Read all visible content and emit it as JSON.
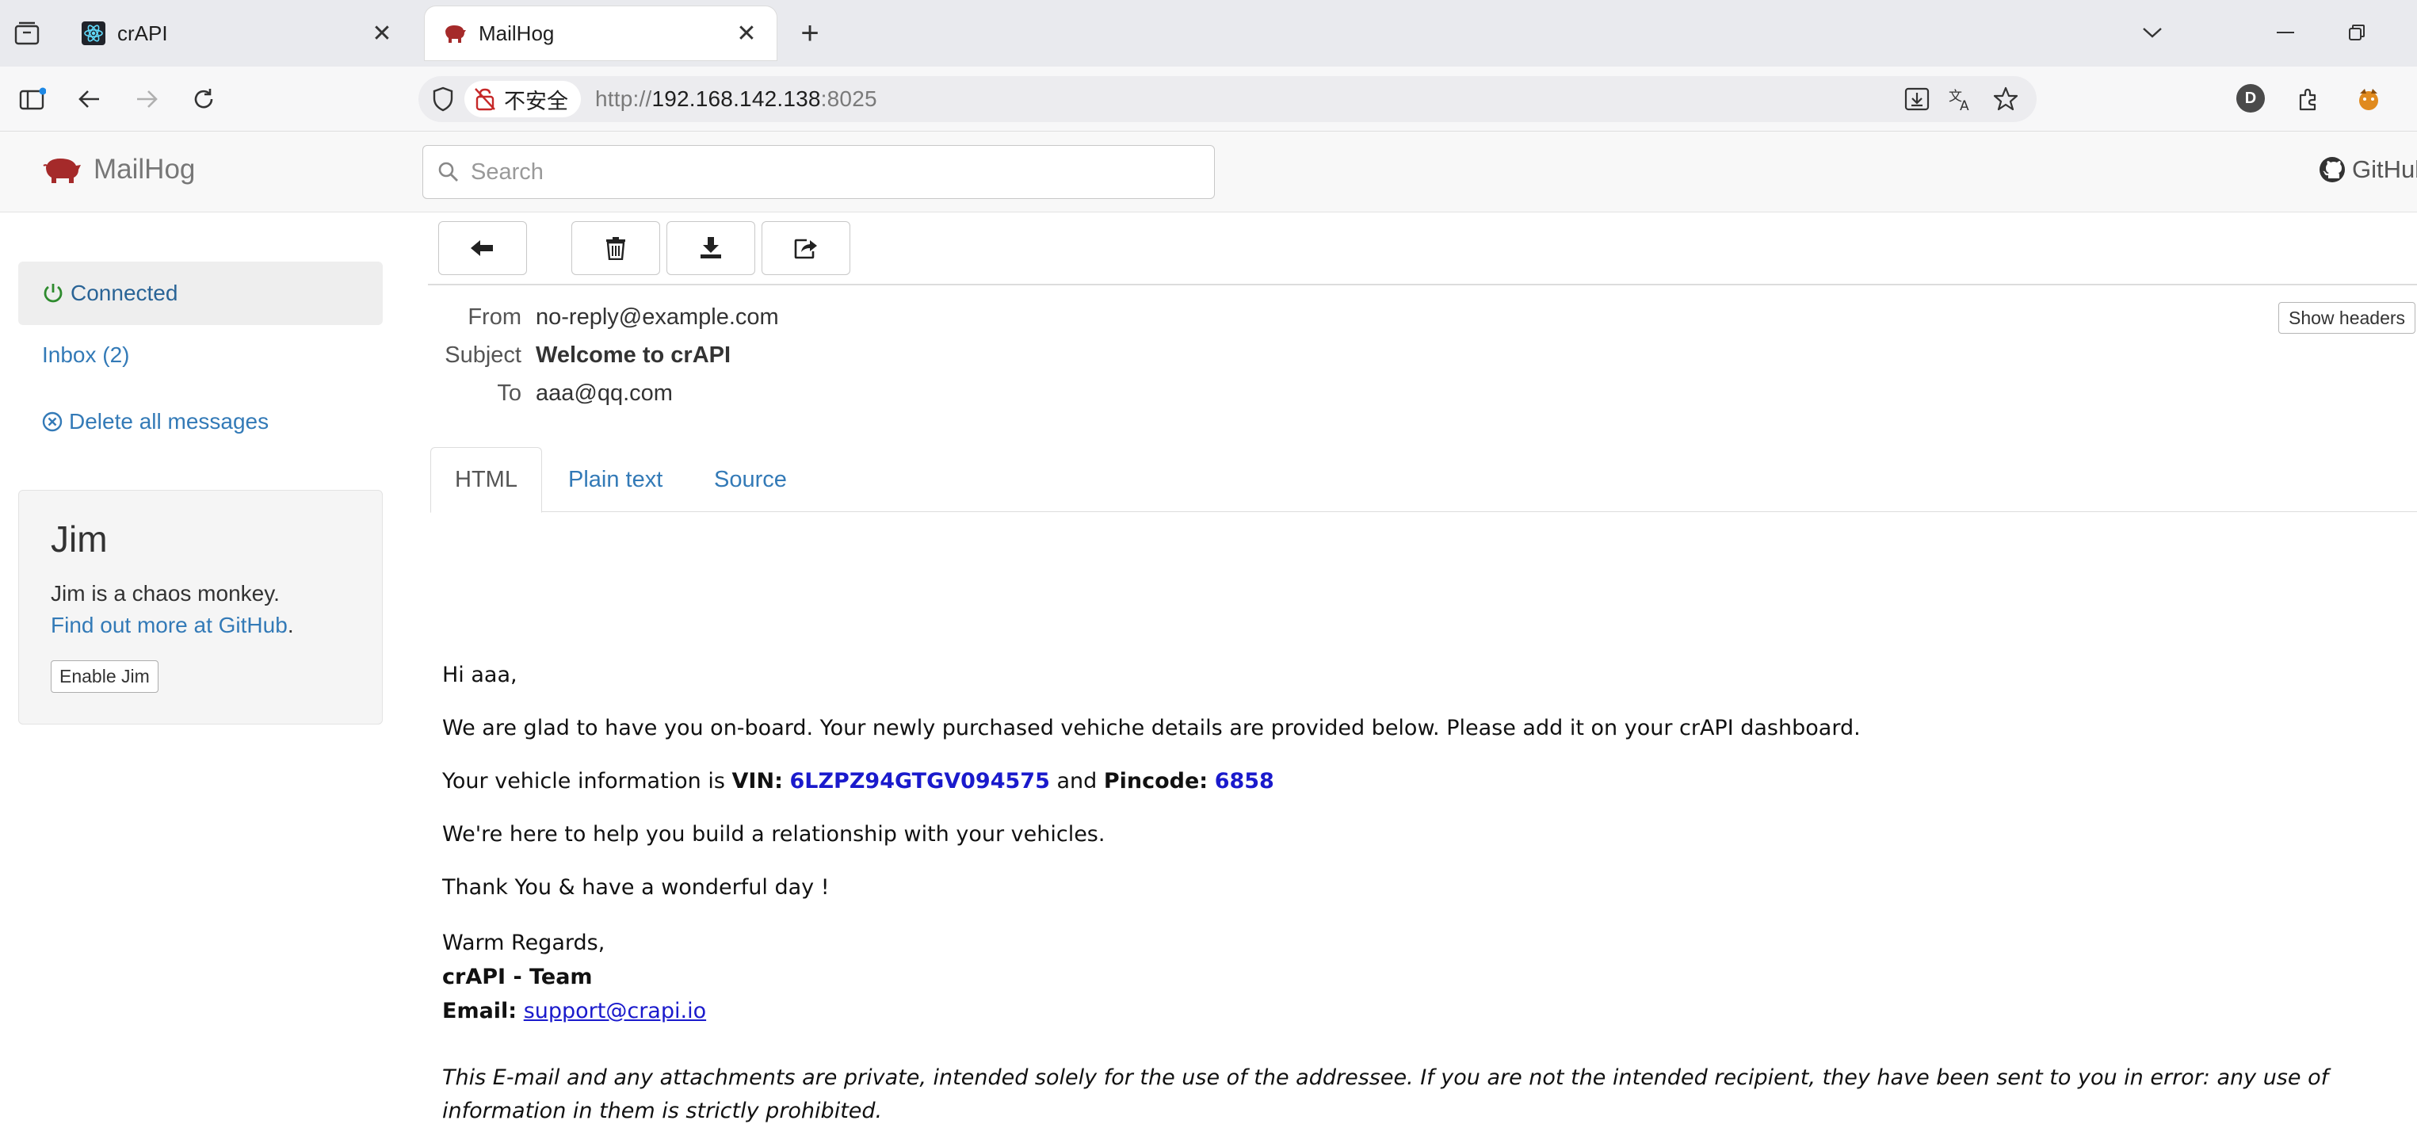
{
  "browser": {
    "tabs": [
      {
        "title": "crAPI",
        "active": false
      },
      {
        "title": "MailHog",
        "active": true
      }
    ],
    "security_label": "不安全",
    "url_scheme": "http://",
    "url_host": "192.168.142.138",
    "url_port": ":8025",
    "profile_initial": "D"
  },
  "mailhog": {
    "brand": "MailHog",
    "search_placeholder": "Search",
    "github_label": "GitHub"
  },
  "sidebar": {
    "connected": "Connected",
    "inbox": "Inbox (2)",
    "delete_all": "Delete all messages",
    "jim": {
      "title": "Jim",
      "text": "Jim is a chaos monkey.",
      "link": "Find out more at GitHub",
      "link_suffix": ".",
      "button": "Enable Jim"
    }
  },
  "message": {
    "headers": {
      "from_label": "From",
      "from": "no-reply@example.com",
      "subject_label": "Subject",
      "subject": "Welcome to crAPI",
      "to_label": "To",
      "to": "aaa@qq.com"
    },
    "show_headers": "Show headers",
    "tabs": [
      "HTML",
      "Plain text",
      "Source"
    ],
    "body": {
      "greeting": "Hi aaa,",
      "line1": "We are glad to have you on-board. Your newly purchased vehiche details are provided below. Please add it on your crAPI dashboard.",
      "vin_prefix": "Your vehicle information is ",
      "vin_label": "VIN:",
      "vin": "6LZPZ94GTGV094575",
      "and": " and ",
      "pincode_label": "Pincode:",
      "pincode": "6858",
      "line3": "We're here to help you build a relationship with your vehicles.",
      "line4": "Thank You & have a wonderful day !",
      "regards": "Warm Regards,",
      "team": "crAPI - Team",
      "email_label": "Email:",
      "email": "support@crapi.io",
      "disclaimer": "This E-mail and any attachments are private, intended solely for the use of the addressee. If you are not the intended recipient, they have been sent to you in error: any use of information in them is strictly prohibited."
    }
  },
  "colors": {
    "link": "#337ab7",
    "connected_green": "#2e8b2e",
    "brand_red": "#a52a2a",
    "vin_blue": "#1a1acc"
  }
}
